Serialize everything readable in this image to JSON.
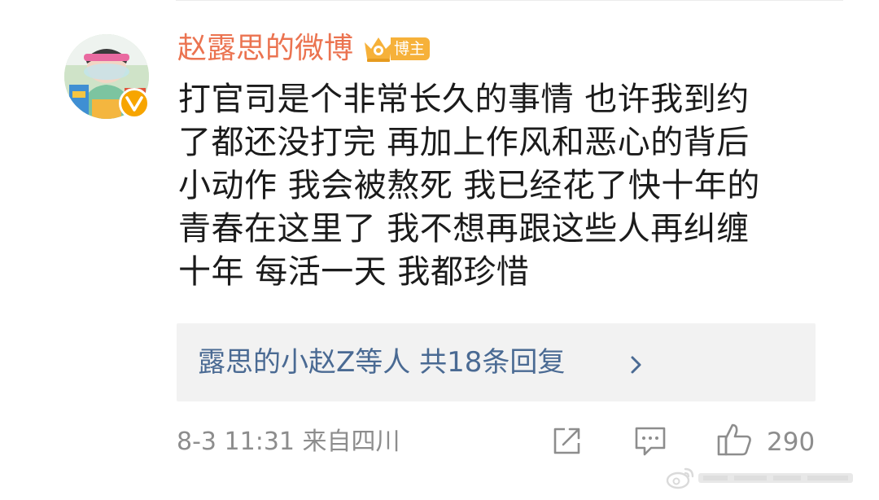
{
  "comment": {
    "username": "赵露思的微博",
    "badge": "博主",
    "lines": [
      "打官司是个非常长久的事情 也许我到约",
      "了都还没打完 再加上作风和恶心的背后",
      "小动作 我会被熬死 我已经花了快十年的",
      "青春在这里了 我不想再跟这些人再纠缠",
      "十年 每活一天 我都珍惜"
    ],
    "replies": "露思的小赵Z等人  共18条回复",
    "meta": "8-3 11:31  来自四川",
    "likes": "290"
  },
  "icons": {
    "verified": "verified-v-icon",
    "badge": "crown-badge-icon",
    "replies": "chevron-right-icon",
    "share": "share-icon",
    "comment": "comment-icon",
    "like": "thumbs-up-icon",
    "watermark": "weibo-logo-icon"
  },
  "colors": {
    "username": "#eb7350",
    "link": "#4a6a93",
    "meta": "#8d8d8d",
    "reply_bg": "#f2f2f2",
    "verified": "#f7a500",
    "badge": "#f6b13a"
  }
}
